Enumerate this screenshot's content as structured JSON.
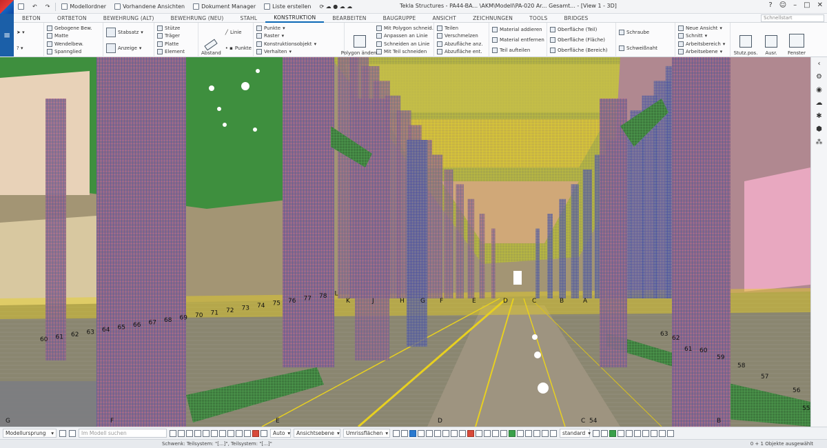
{
  "titlebar": {
    "quick_access": [
      "Modellordner",
      "Vorhandene Ansichten",
      "Dokument Manager",
      "Liste erstellen"
    ],
    "window_title": "Tekla Structures - PA44-BA... \\AKM\\Modell\\PA-020 Ar... Gesamt... - [View 1 - 3D]",
    "help": "?",
    "user_icon": "user-icon"
  },
  "tabs": [
    "BETON",
    "ORTBETON",
    "BEWEHRUNG (ALT)",
    "BEWEHRUNG (NEU)",
    "STAHL",
    "KONSTRUKTION",
    "BEARBEITEN",
    "BAUGRUPPE",
    "ANSICHT",
    "ZEICHNUNGEN",
    "TOOLS",
    "BRIDGES"
  ],
  "active_tab": "KONSTRUKTION",
  "search_placeholder": "Schnellstart",
  "ribbon": {
    "group1": [
      "Gebogene Bew.",
      "Matte",
      "Wendelbew.",
      "Spannglied"
    ],
    "group2_big": [
      "Stabsatz",
      "Anzeige"
    ],
    "group3": [
      "Stütze",
      "Träger",
      "Platte",
      "Element"
    ],
    "group4_big": [
      "Abstand",
      "Linie",
      "Punkte"
    ],
    "group5": [
      "Punkte",
      "Raster",
      "Konstruktionsobjekt",
      "Verhalten"
    ],
    "group6_big": "Polygon ändern",
    "group6": [
      "Mit Polygon schneid.",
      "Anpassen an Linie",
      "Schneiden an Linie",
      "Mit Teil schneiden"
    ],
    "group7": [
      "Teilen",
      "Verschmelzen",
      "Abzufläche anz.",
      "Abzufläche ent."
    ],
    "group8": [
      "Material addieren",
      "Material entfernen",
      "Teil aufteilen"
    ],
    "group9": [
      "Oberfläche (Teil)",
      "Oberfläche (Fläche)",
      "Oberfläche (Bereich)"
    ],
    "group10": [
      "Schraube",
      "Schweißnaht"
    ],
    "group11": [
      "Neue Ansicht",
      "Schnitt",
      "Arbeitsbereich",
      "Arbeitsebene"
    ],
    "group12_big": [
      "Stutz.pos.",
      "Ausr.",
      "Fenster"
    ]
  },
  "viewport": {
    "grid_labels_left": [
      "60",
      "61",
      "62",
      "63",
      "64",
      "65",
      "66",
      "67",
      "68",
      "69",
      "70",
      "71",
      "72",
      "73",
      "74",
      "75",
      "76",
      "77",
      "78",
      "L"
    ],
    "grid_letters": [
      "K",
      "J",
      "H",
      "G",
      "F",
      "E",
      "D",
      "C",
      "B",
      "A"
    ],
    "grid_labels_right": [
      "62",
      "61",
      "60",
      "59",
      "58",
      "57",
      "56",
      "55",
      "63"
    ],
    "bottom_letters": [
      "G",
      "F",
      "E",
      "D",
      "C",
      "54",
      "B"
    ],
    "colors": {
      "concrete": "#d6b84a",
      "rebar_blue": "#4a55b0",
      "rebar_pink": "#c06a8a",
      "rebar_green": "#3a9a4a",
      "rebar_yellow": "#e8d020",
      "beam_green": "#3e8f3e",
      "floor": "#8f8a70"
    }
  },
  "bottombar": {
    "snap_combo": "Modellursprung",
    "search_placeholder": "Im Modell suchen",
    "combo_auto": "Auto",
    "combo_ansicht": "Ansichtsebene",
    "combo_umrisse": "Umrissflächen",
    "combo_standard": "standard"
  },
  "statusbar": {
    "left": "Schwenk: Teilsystem: \"[...]\", Teilsystem: \"[...]\"",
    "right": "0 + 1 Objekte ausgewählt"
  }
}
